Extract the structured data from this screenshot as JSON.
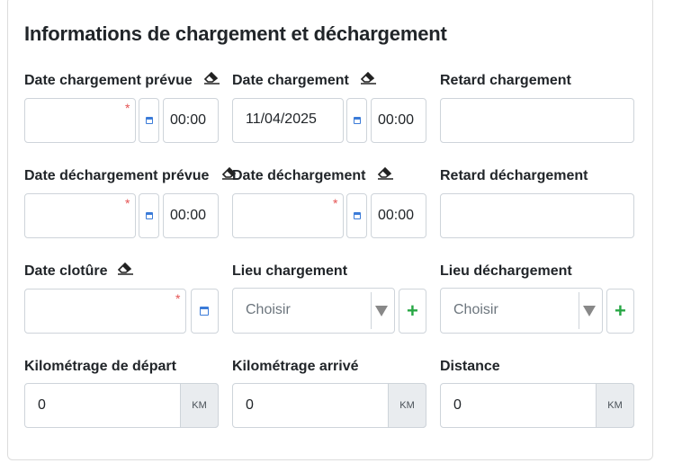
{
  "section": {
    "title": "Informations de chargement et déchargement"
  },
  "row1": {
    "date_chargement_prevue": {
      "label": "Date chargement prévue",
      "time": "00:00"
    },
    "date_chargement": {
      "label": "Date chargement",
      "date": "11/04/2025",
      "time": "00:00"
    },
    "retard_chargement": {
      "label": "Retard chargement"
    }
  },
  "row2": {
    "date_dechargement_prevue": {
      "label": "Date déchargement prévue",
      "time": "00:00"
    },
    "date_dechargement": {
      "label": "Date déchargement",
      "time": "00:00"
    },
    "retard_dechargement": {
      "label": "Retard déchargement"
    }
  },
  "row3": {
    "date_cloture": {
      "label": "Date clotûre"
    },
    "lieu_chargement": {
      "label": "Lieu chargement",
      "selected": "Choisir"
    },
    "lieu_dechargement": {
      "label": "Lieu déchargement",
      "selected": "Choisir"
    }
  },
  "row4": {
    "km_depart": {
      "label": "Kilométrage de départ",
      "value": "0",
      "unit": "KM"
    },
    "km_arrive": {
      "label": "Kilométrage arrivé",
      "value": "0",
      "unit": "KM"
    },
    "distance": {
      "label": "Distance",
      "value": "0",
      "unit": "KM"
    }
  },
  "required_mark": "*",
  "add_symbol": "+",
  "colors": {
    "required": "#e55353",
    "add": "#28a745",
    "calendar": "#3b7bd8"
  },
  "icons": {
    "eraser": "eraser-icon",
    "calendar": "calendar-icon",
    "dropdown": "chevron-down-icon",
    "add": "plus-icon"
  }
}
